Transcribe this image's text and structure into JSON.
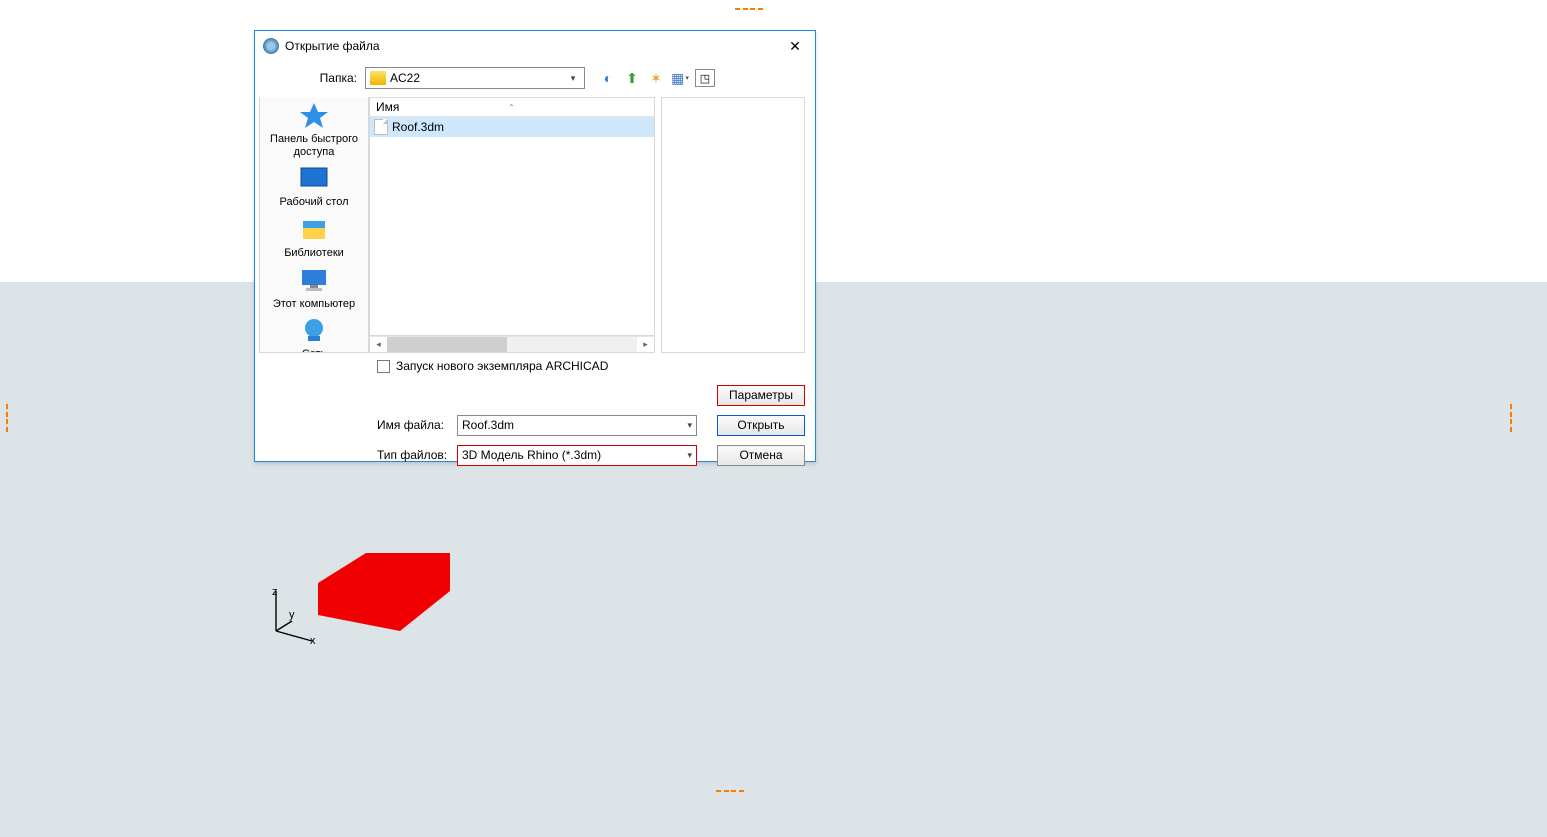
{
  "dialog": {
    "title": "Открытие файла",
    "folder_label": "Папка:",
    "folder_value": "AC22",
    "places": {
      "quick": "Панель быстрого доступа",
      "desktop": "Рабочий стол",
      "libs": "Библиотеки",
      "thispc": "Этот компьютер",
      "network": "Сеть"
    },
    "file_header": "Имя",
    "file_row": "Roof.3dm",
    "checkbox_label": "Запуск нового экземпляра ARCHICAD",
    "params_btn": "Параметры",
    "filename_label": "Имя файла:",
    "filename_value": "Roof.3dm",
    "filetype_label": "Тип файлов:",
    "filetype_value": "3D Модель Rhino (*.3dm)",
    "open_btn": "Открыть",
    "cancel_btn": "Отмена"
  },
  "axes": {
    "x": "x",
    "y": "y",
    "z": "z"
  }
}
